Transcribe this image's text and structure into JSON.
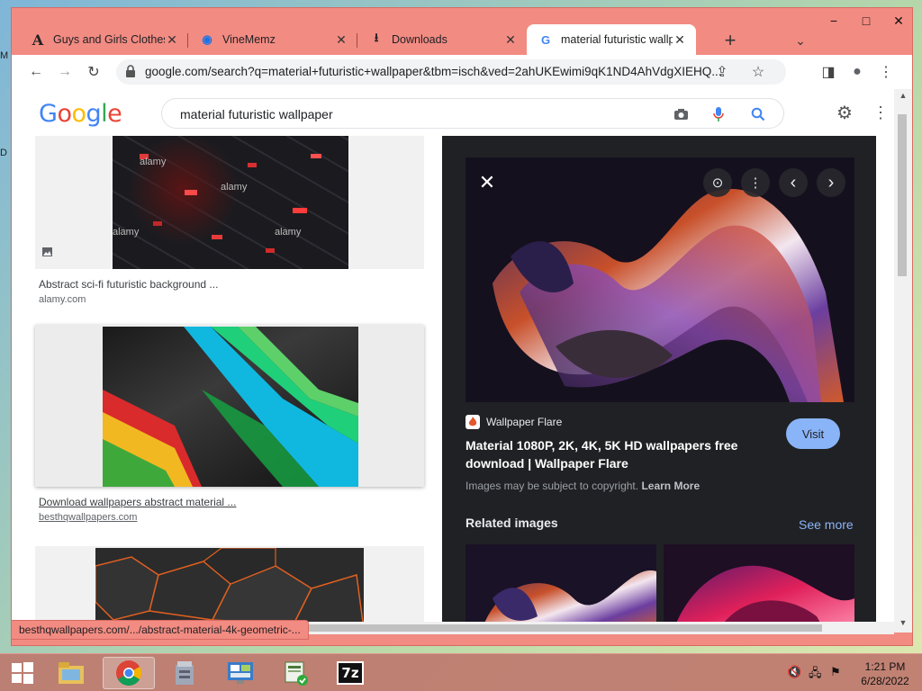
{
  "desktop": {
    "left_labels": [
      "M",
      "D"
    ]
  },
  "window_controls": {
    "minimize": "−",
    "maximize": "□",
    "close": "✕"
  },
  "tabs": [
    {
      "favicon": "A",
      "title": "Guys and Girls Clothes",
      "close": "✕"
    },
    {
      "favicon": "◉",
      "title": "VineMemz",
      "close": "✕"
    },
    {
      "favicon": "⭳",
      "title": "Downloads",
      "close": "✕"
    },
    {
      "favicon": "G",
      "title": "material futuristic wallp",
      "close": "✕"
    }
  ],
  "new_tab": "+",
  "tab_list": "⌄",
  "toolbar": {
    "back": "←",
    "forward": "→",
    "reload": "↻",
    "url": "google.com/search?q=material+futuristic+wallpaper&tbm=isch&ved=2ahUKEwimi9qK1ND4AhVdgXIEHQ...",
    "share": "⇪",
    "bookmark": "☆",
    "sidepanel": "◨",
    "profile": "●",
    "menu": "⋮"
  },
  "search": {
    "logo": [
      "G",
      "o",
      "o",
      "g",
      "l",
      "e"
    ],
    "logo_colors": [
      "#4285f4",
      "#ea4335",
      "#fbbc05",
      "#4285f4",
      "#34a853",
      "#ea4335"
    ],
    "query": "material futuristic wallpaper",
    "camera_icon": "📷",
    "mic_icon": "🎤",
    "search_icon": "🔍",
    "settings_icon": "⚙",
    "apps_icon": "⋮⋮"
  },
  "results": [
    {
      "caption": "Abstract sci-fi futuristic background ...",
      "site": "alamy.com",
      "watermark": "alamy"
    },
    {
      "caption": "Download wallpapers abstract material ...",
      "site": "besthqwallpapers.com"
    },
    {
      "caption": "",
      "site": ""
    }
  ],
  "preview": {
    "close": "✕",
    "lens_icon": "⊙",
    "more_icon": "⋮",
    "prev_icon": "‹",
    "next_icon": "›",
    "source": "Wallpaper Flare",
    "title": "Material 1080P, 2K, 4K, 5K HD wallpapers free download | Wallpaper Flare",
    "visit": "Visit",
    "copyright": "Images may be subject to copyright.",
    "learn_more": "Learn More",
    "related": "Related images",
    "see_more": "See more"
  },
  "status_url": "besthqwallpapers.com/.../abstract-material-4k-geometric-...",
  "scroll": {
    "up": "▲",
    "down": "▼"
  },
  "taskbar": {
    "items": [
      "file-explorer",
      "chrome",
      "archive-tool",
      "control-panel",
      "office-tool",
      "7zip"
    ],
    "sevenzip_label": "7z",
    "tray_icons": [
      "🔇",
      "🖧",
      "⚑"
    ],
    "time": "1:21 PM",
    "date": "6/28/2022"
  }
}
